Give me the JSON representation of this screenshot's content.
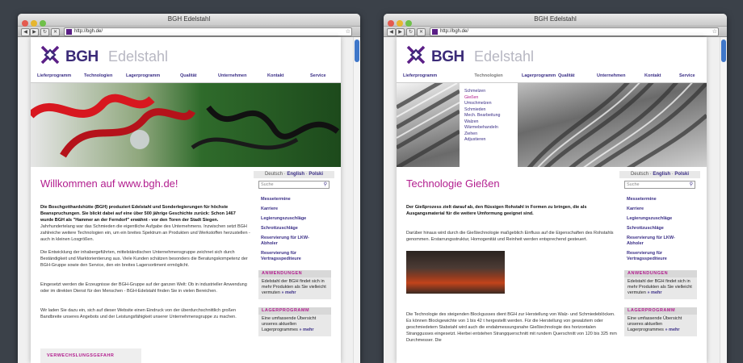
{
  "windows": [
    {
      "title": "BGH Edelstahl",
      "url": "http://bgh.de/",
      "logo": {
        "bgh": "BGH",
        "edelstahl": "Edelstahl"
      },
      "nav": [
        "Lieferprogramm",
        "Technologien",
        "Lagerprogramm",
        "Qualität",
        "Unternehmen",
        "Kontakt",
        "Service"
      ],
      "heading": "Willkommen auf www.bgh.de!",
      "lead": "Die Boschgotthardshütte (BGH) produziert Edelstahl und Sonderlegierungen für höchste Beanspruchungen. Sie blickt dabei auf eine über 500 jährige Geschichte zurück: Schon 1467 wurde BGH als \"Hammer an der Ferndorf\" erwähnt - vor den Toren der Stadt Siegen.",
      "paragraphs": [
        "Jahrhundertelang war das Schmieden die eigentliche Aufgabe des Unternehmens. Inzwischen setzt BGH zahlreiche weitere Technologien ein, um ein breites Spektrum an Produkten und Werkstoffen herzustellen - auch in kleinen Losgrößen.",
        "Die Entwicklung der inhabergeführten, mittelständischen Unternehmensgruppe zeichnet sich durch Beständigkeit und Marktorientierung aus. Viele Kunden schätzen besonders die Beratungskompetenz der BGH-Gruppe sowie den Service, den ein breites Lagersortiment ermöglicht.",
        "Eingesetzt werden die Erzeugnisse der BGH-Gruppe auf der ganzen Welt: Ob in industrieller Anwendung oder im direkten Dienst für den Menschen - BGH-Edelstahl finden Sie in vielen Bereichen.",
        "Wir laden Sie dazu ein, sich auf dieser Website einen Eindruck von der überdurchschnittlich großen Bandbreite unseres Angebots und der Leistungsfähigkeit unserer Unternehmensgruppe zu machen."
      ],
      "warning": "VERWECHSLUNGSGEFAHR"
    },
    {
      "title": "BGH Edelstahl",
      "url": "http://bgh.de/",
      "logo": {
        "bgh": "BGH",
        "edelstahl": "Edelstahl"
      },
      "nav": [
        "Lieferprogramm",
        "Technologien",
        "Lagerprogramm",
        "Qualität",
        "Unternehmen",
        "Kontakt",
        "Service"
      ],
      "dropdown": [
        "Schmelzen",
        "Gießen",
        "Umschmelzen",
        "Schmieden",
        "Mech. Bearbeitung",
        "Walzen",
        "Wärmebehandeln",
        "Ziehen",
        "Adjustieren"
      ],
      "heading": "Technologie Gießen",
      "lead": "Der Gießprozess zielt darauf ab, den flüssigen Rohstahl in Formen zu bringen, die als Ausgangsmaterial für die weitere Umformung geeignet sind.",
      "paragraphs": [
        "Darüber hinaus wird durch die Gießtechnologie maßgeblich Einfluss auf die Eigenschaften des Rohstahls genommen. Erstarrungsstruktur, Homogenität und Reinheit werden entsprechend gesteuert.",
        "Die Technologie des steigenden Blockgusses dient BGH zur Herstellung von Walz- und Schmiedeblöcken. Es können Blockgewichte von 1 bis 42 t hergestellt werden. Für die Herstellung von gewalztem oder geschmiedetem Stabstahl wird auch die endabmessungsnahe Gießtechnologie des horizontalen Stranggusses eingesetzt. Hierbei entstehen Strangquerschnitt mit rundem Querschnitt von 120 bis 325 mm Durchmesser. Die"
      ]
    }
  ],
  "sidebar": {
    "lang": {
      "de": "Deutsch",
      "sep1": " · ",
      "en": "English",
      "sep2": " · ",
      "pl": "Polski"
    },
    "search_placeholder": "Suche",
    "links": [
      "Messetermine",
      "Karriere",
      "Legierungszuschläge",
      "Schrottzuschläge",
      "Reservierung für LKW-Abholer",
      "Reservierung für Vertragsspediteure"
    ],
    "box1": {
      "title": "ANWENDUNGEN",
      "text": "Edelstahl der BGH findet sich in mehr Produkten als Sie vielleicht vermuten",
      "more": "» mehr"
    },
    "box2": {
      "title": "LAGERPROGRAMM",
      "text": "Eine umfassende Übersicht unseres aktuellen Lagerprogrammes",
      "more": "» mehr"
    }
  },
  "colors": {
    "brand": "#3a2e86",
    "accent": "#b21d8e"
  }
}
